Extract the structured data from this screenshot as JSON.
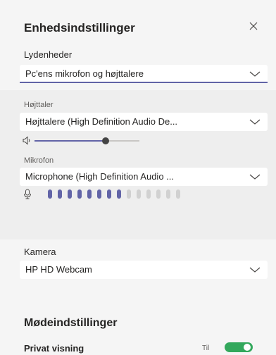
{
  "header": {
    "title": "Enhedsindstillinger",
    "close_icon": "close-icon"
  },
  "audio": {
    "label": "Lydenheder",
    "selected": "Pc'ens mikrofon og højttalere"
  },
  "speaker": {
    "label": "Højttaler",
    "selected": "Højttalere (High Definition Audio De...",
    "volume_percent": 68,
    "icon": "speaker-icon"
  },
  "microphone": {
    "label": "Mikrofon",
    "selected": "Microphone (High Definition Audio ...",
    "level_total": 14,
    "level_active": 8,
    "icon": "microphone-icon"
  },
  "camera": {
    "label": "Kamera",
    "selected": "HP HD Webcam"
  },
  "meeting": {
    "title": "Mødeindstillinger",
    "private_label": "Privat visning",
    "toggle_state": "Til",
    "toggle_on": true
  },
  "colors": {
    "accent": "#6264a7",
    "toggle_on": "#33a85c"
  }
}
